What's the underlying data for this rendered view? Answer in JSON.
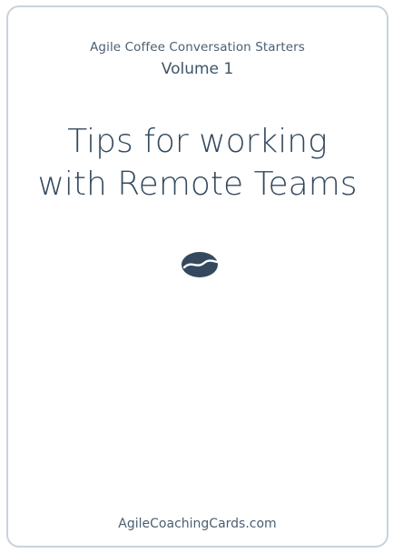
{
  "card": {
    "series": "Agile Coffee Conversation Starters",
    "volume": "Volume 1",
    "title_lines": [
      "Tips for working",
      "with Remote Teams"
    ],
    "icon": "coffee-bean-icon",
    "footer": "AgileCoachingCards.com"
  },
  "colors": {
    "text": "#34495e",
    "border": "#c9d2da",
    "background": "#ffffff"
  }
}
